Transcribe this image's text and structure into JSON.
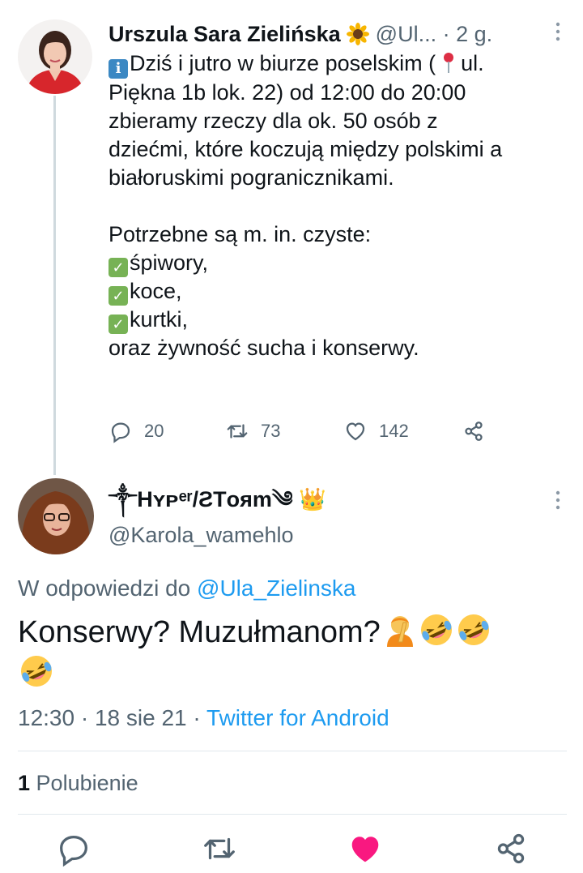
{
  "parent_tweet": {
    "author_name": "Urszula Sara Zielińska",
    "name_emoji": "sunflower",
    "handle": "@Ul...",
    "separator": "·",
    "time": "2 g.",
    "lines": [
      "Dziś i jutro w biurze poselskim (",
      "ul.",
      "Piękna 1b lok. 22) od 12:00 do 20:00",
      "zbieramy rzeczy dla ok. 50 osób z",
      "dziećmi, które koczują między polskimi a",
      "białoruskimi pogranicznikami.",
      "Potrzebne są m. in. czyste:",
      "śpiwory,",
      "koce,",
      "kurtki,",
      "oraz żywność sucha i konserwy."
    ],
    "info_glyph": "i",
    "check_glyph": "✓",
    "reply_count": "20",
    "retweet_count": "73",
    "like_count": "142"
  },
  "reply_tweet": {
    "display_name": "༒Hʏᴘᵉʳ/ƧTᴏяm༄ 👑",
    "handle": "@Karola_wamehlo",
    "reply_prefix": "W odpowiedzi do",
    "reply_mention": "@Ula_Zielinska",
    "text": "Konserwy? Muzułmanom?",
    "timestamp": "12:30 · 18 sie 21 ·",
    "source": "Twitter for Android",
    "likes_count": "1",
    "likes_label": "Polubienie"
  },
  "colors": {
    "accent": "#1d9bf0",
    "like_active": "#f91880",
    "secondary_text": "#536471",
    "divider": "#e1e8ed"
  },
  "icons": {
    "reply": "reply-icon",
    "retweet": "retweet-icon",
    "like": "heart-icon",
    "share": "share-icon",
    "more": "more-options-icon",
    "location": "round-pushpin-icon",
    "facepalm": "facepalm-emoji-icon",
    "laugh": "rolling-on-floor-laughing-emoji-icon"
  }
}
